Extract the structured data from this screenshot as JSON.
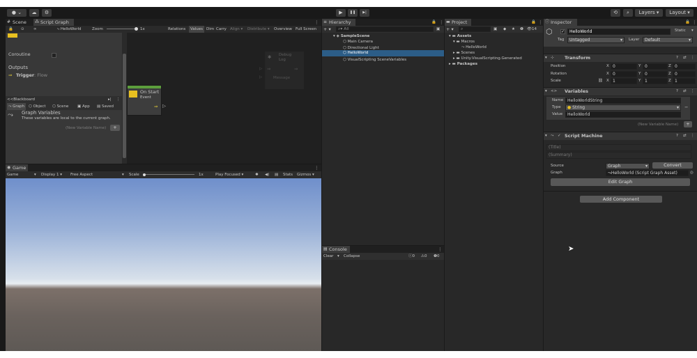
{
  "toolbar": {
    "account": "● ⌄",
    "play": "▶",
    "pause": "❚❚",
    "step": "▶|",
    "layers": "Layers",
    "layout": "Layout"
  },
  "scene_panel": {
    "tabs": [
      "Scene",
      "Script Graph"
    ],
    "breadcrumb": "HelloWorld",
    "zoom_label": "Zoom",
    "zoom_value": "1x",
    "toggles": [
      "Relations",
      "Values",
      "Dim",
      "Carry",
      "Align ▾",
      "Distribute ▾",
      "Overview",
      "Full Screen"
    ]
  },
  "graph_inspector": {
    "coroutine_label": "Coroutine",
    "outputs_label": "Outputs",
    "trigger_label": "Trigger",
    "trigger_type": ": Flow"
  },
  "blackboard": {
    "title": "Blackboard",
    "tabs": [
      "Graph",
      "Object",
      "Scene",
      "App",
      "Saved"
    ],
    "section_title": "Graph Variables",
    "section_desc": "These variables are local to the current graph.",
    "new_var_placeholder": "(New Variable Name)"
  },
  "nodes": {
    "on_start_title": "On Start",
    "on_start_sub": "Event",
    "debug_title": "Debug",
    "debug_sub": "Log",
    "message_label": "Message"
  },
  "game_panel": {
    "tab": "Game",
    "view_select": "Game",
    "display": "Display 1",
    "aspect": "Free Aspect",
    "scale_label": "Scale",
    "scale_value": "1x",
    "play_mode": "Play Focused",
    "stats": "Stats",
    "gizmos": "Gizmos"
  },
  "hierarchy": {
    "tab": "Hierarchy",
    "search_placeholder": "All",
    "scene": "SampleScene",
    "items": [
      "Main Camera",
      "Directional Light",
      "HelloWorld",
      "VisualScripting SceneVariables"
    ],
    "selected_index": 2
  },
  "console": {
    "tab": "Console",
    "clear": "Clear",
    "collapse": "Collapse",
    "counts": [
      "0",
      "0",
      "0"
    ]
  },
  "project": {
    "tab": "Project",
    "count": "14",
    "tree": [
      "Assets",
      "Macros",
      "HelloWorld",
      "Scenes",
      "Unity.VisualScripting.Generated",
      "Packages"
    ]
  },
  "inspector": {
    "tab": "Inspector",
    "object_name": "HelloWorld",
    "static_label": "Static",
    "tag_label": "Tag",
    "tag_value": "Untagged",
    "layer_label": "Layer",
    "layer_value": "Default",
    "transform": {
      "title": "Transform",
      "rows": [
        {
          "label": "Position",
          "x": "0",
          "y": "0",
          "z": "0"
        },
        {
          "label": "Rotation",
          "x": "0",
          "y": "0",
          "z": "0"
        },
        {
          "label": "Scale",
          "x": "1",
          "y": "1",
          "z": "1"
        }
      ]
    },
    "variables": {
      "title": "Variables",
      "name_label": "Name",
      "name_value": "HelloWorldString",
      "type_label": "Type",
      "type_value": "String",
      "value_label": "Value",
      "value_value": "HelloWorld",
      "new_var_placeholder": "(New Variable Name)"
    },
    "script_machine": {
      "title": "Script Machine",
      "title_placeholder": "(Title)",
      "summary_placeholder": "(Summary)",
      "source_label": "Source",
      "source_value": "Graph",
      "convert": "Convert",
      "graph_label": "Graph",
      "graph_value": "HelloWorld (Script Graph Asset)",
      "edit_graph": "Edit Graph"
    },
    "add_component": "Add Component"
  },
  "colors": {
    "accent": "#2c5d87",
    "flow_yellow": "#e8d23a",
    "node_header": "#5c9e3c",
    "blue_strip": "#0e4fc6"
  }
}
